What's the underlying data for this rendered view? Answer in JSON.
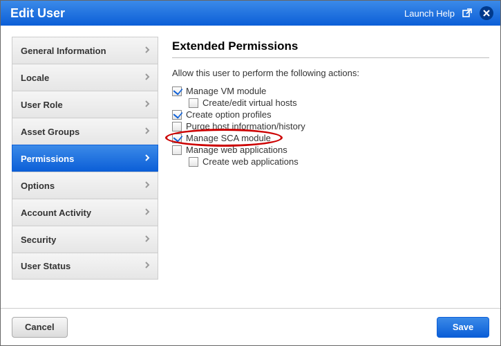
{
  "header": {
    "title": "Edit User",
    "launch_help": "Launch Help"
  },
  "sidebar": {
    "items": [
      {
        "label": "General Information"
      },
      {
        "label": "Locale"
      },
      {
        "label": "User Role"
      },
      {
        "label": "Asset Groups"
      },
      {
        "label": "Permissions"
      },
      {
        "label": "Options"
      },
      {
        "label": "Account Activity"
      },
      {
        "label": "Security"
      },
      {
        "label": "User Status"
      }
    ],
    "active_index": 4
  },
  "content": {
    "heading": "Extended Permissions",
    "intro": "Allow this user to perform the following actions:",
    "permissions": [
      {
        "label": "Manage VM module",
        "checked": true,
        "indent": false
      },
      {
        "label": "Create/edit virtual hosts",
        "checked": false,
        "indent": true
      },
      {
        "label": "Create option profiles",
        "checked": true,
        "indent": false
      },
      {
        "label": "Purge host information/history",
        "checked": false,
        "indent": false
      },
      {
        "label": "Manage SCA module",
        "checked": true,
        "indent": false,
        "highlight": true
      },
      {
        "label": "Manage web applications",
        "checked": false,
        "indent": false
      },
      {
        "label": "Create web applications",
        "checked": false,
        "indent": true
      }
    ]
  },
  "footer": {
    "cancel": "Cancel",
    "save": "Save"
  }
}
